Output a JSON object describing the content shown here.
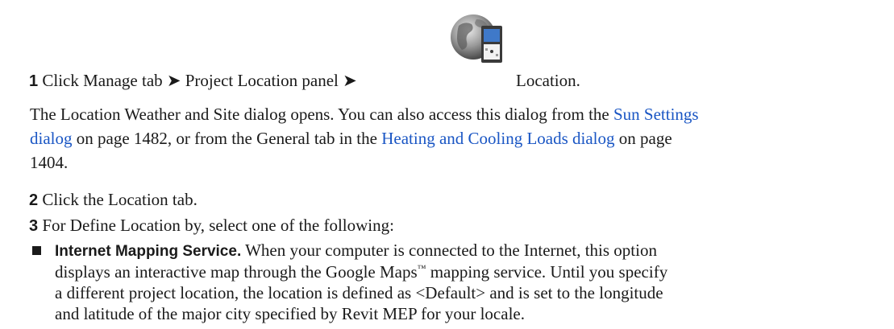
{
  "step1": {
    "number": "1",
    "text": "Click Manage tab ➤ Project Location panel ➤",
    "text_after": "Location."
  },
  "step1_note": {
    "line1_prefix": "The Location Weather and Site dialog opens. You can also access this dialog from the",
    "link1_part1": "Sun Settings",
    "link1_part2": "dialog",
    "line2_mid": "on page 1482, or from the General tab in the",
    "link2": "Heating and Cooling Loads dialog",
    "line2_suffix": "on page",
    "line3": "1404."
  },
  "step2": {
    "number": "2",
    "text": "Click the Location tab."
  },
  "step3": {
    "number": "3",
    "text": "For Define Location by, select one of the following:"
  },
  "option1": {
    "title": "Internet Mapping Service.",
    "line1": "When your computer is connected to the Internet, this option",
    "line2_prefix": "displays an interactive map through the Google Maps",
    "tm": "™",
    "line2_suffix": "mapping service. Until you specify",
    "line3": "a different project location, the location is defined as <Default> and is set to the longitude",
    "line4": "and latitude of the major city specified by Revit MEP for your locale."
  },
  "icon": "location-globe-icon"
}
